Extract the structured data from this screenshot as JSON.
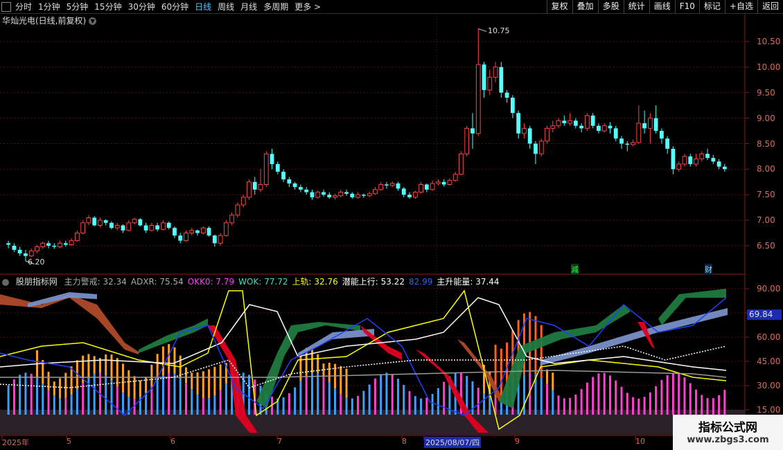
{
  "toolbar": {
    "periods": [
      "分时",
      "1分钟",
      "5分钟",
      "15分钟",
      "30分钟",
      "60分钟",
      "日线",
      "周线",
      "月线",
      "多周期",
      "更多 >"
    ],
    "active_period": "日线",
    "actions": [
      "复权",
      "叠加",
      "多股",
      "统计",
      "画线",
      "F10",
      "标记",
      "+自选",
      "返回"
    ]
  },
  "main_chart": {
    "title": "华灿光电(日线,前复权)",
    "price_axis": [
      "10.50",
      "10.00",
      "9.50",
      "9.00",
      "8.50",
      "8.00",
      "7.50",
      "7.00",
      "6.50"
    ],
    "high_label": "10.75",
    "low_label": "6.20",
    "marker_jian": "減",
    "marker_cai": "财"
  },
  "indicator": {
    "name": "股朋指标网",
    "fields": [
      {
        "label": "主力警戒: 32.34",
        "color": "#aaaaaa"
      },
      {
        "label": "ADXR: 75.54",
        "color": "#aaaaaa"
      },
      {
        "label": "OKK0: 7.79",
        "color": "#ff40ff"
      },
      {
        "label": "WOK: 77.72",
        "color": "#3fe0c0"
      },
      {
        "label": "上轨: 32.76",
        "color": "#ffff00"
      },
      {
        "label": "潜能上行: 53.22",
        "color": "#ffffff"
      },
      {
        "label": "82.99",
        "color": "#3060ff"
      },
      {
        "label": "主升能量: 37.44",
        "color": "#ffffff"
      }
    ],
    "axis": [
      "90.00",
      "75.00",
      "60.00",
      "45.00",
      "30.00",
      "15.00"
    ],
    "current_value": "69.84"
  },
  "date_axis": [
    "2025年",
    "5",
    "6",
    "7",
    "8",
    "2025/08/07/四",
    "9",
    "10"
  ],
  "watermark": {
    "line1": "指标公式网",
    "line2": "www.zbgs3.com"
  },
  "chart_data": {
    "type": "candlestick",
    "title": "华灿光电(日线,前复权)",
    "ylim": [
      6.0,
      11.0
    ],
    "high": 10.75,
    "low": 6.2,
    "candles": [
      [
        6.55,
        6.52,
        6.6,
        6.45
      ],
      [
        6.5,
        6.42,
        6.55,
        6.38
      ],
      [
        6.42,
        6.35,
        6.48,
        6.3
      ],
      [
        6.35,
        6.3,
        6.42,
        6.2
      ],
      [
        6.3,
        6.4,
        6.45,
        6.28
      ],
      [
        6.4,
        6.48,
        6.52,
        6.35
      ],
      [
        6.48,
        6.55,
        6.58,
        6.44
      ],
      [
        6.55,
        6.5,
        6.6,
        6.45
      ],
      [
        6.5,
        6.48,
        6.55,
        6.44
      ],
      [
        6.48,
        6.55,
        6.6,
        6.45
      ],
      [
        6.55,
        6.52,
        6.6,
        6.48
      ],
      [
        6.52,
        6.6,
        6.65,
        6.5
      ],
      [
        6.6,
        6.75,
        6.8,
        6.58
      ],
      [
        6.75,
        6.95,
        7.0,
        6.72
      ],
      [
        6.95,
        7.05,
        7.1,
        6.9
      ],
      [
        7.05,
        6.9,
        7.08,
        6.88
      ],
      [
        6.9,
        7.0,
        7.05,
        6.86
      ],
      [
        7.0,
        6.95,
        7.02,
        6.9
      ],
      [
        6.95,
        6.85,
        6.98,
        6.82
      ],
      [
        6.85,
        6.9,
        6.95,
        6.8
      ],
      [
        6.9,
        6.8,
        6.92,
        6.75
      ],
      [
        6.8,
        6.95,
        7.0,
        6.78
      ],
      [
        6.95,
        7.02,
        7.05,
        6.92
      ],
      [
        7.02,
        6.9,
        7.04,
        6.88
      ],
      [
        6.9,
        6.8,
        6.95,
        6.75
      ],
      [
        6.8,
        6.9,
        6.95,
        6.78
      ],
      [
        6.9,
        6.82,
        6.95,
        6.78
      ],
      [
        6.82,
        6.95,
        7.0,
        6.8
      ],
      [
        6.95,
        6.85,
        6.98,
        6.82
      ],
      [
        6.85,
        6.7,
        6.88,
        6.65
      ],
      [
        6.7,
        6.6,
        6.75,
        6.55
      ],
      [
        6.6,
        6.75,
        6.8,
        6.58
      ],
      [
        6.75,
        6.8,
        6.85,
        6.7
      ],
      [
        6.8,
        6.75,
        6.82,
        6.7
      ],
      [
        6.75,
        6.85,
        6.88,
        6.72
      ],
      [
        6.85,
        6.7,
        6.88,
        6.68
      ],
      [
        6.7,
        6.55,
        6.72,
        6.48
      ],
      [
        6.55,
        6.7,
        6.75,
        6.5
      ],
      [
        6.7,
        6.95,
        7.0,
        6.68
      ],
      [
        6.95,
        7.1,
        7.15,
        6.9
      ],
      [
        7.1,
        7.3,
        7.35,
        7.05
      ],
      [
        7.3,
        7.45,
        7.5,
        7.25
      ],
      [
        7.45,
        7.75,
        7.8,
        7.4
      ],
      [
        7.75,
        7.6,
        7.85,
        7.5
      ],
      [
        7.6,
        7.7,
        8.0,
        7.55
      ],
      [
        7.7,
        8.3,
        8.35,
        7.65
      ],
      [
        8.3,
        8.1,
        8.4,
        8.0
      ],
      [
        8.1,
        7.95,
        8.15,
        7.9
      ],
      [
        7.95,
        7.8,
        8.0,
        7.75
      ],
      [
        7.8,
        7.72,
        7.85,
        7.65
      ],
      [
        7.72,
        7.65,
        7.75,
        7.6
      ],
      [
        7.65,
        7.6,
        7.7,
        7.55
      ],
      [
        7.6,
        7.55,
        7.65,
        7.5
      ],
      [
        7.55,
        7.45,
        7.6,
        7.4
      ],
      [
        7.45,
        7.55,
        7.58,
        7.42
      ],
      [
        7.55,
        7.5,
        7.6,
        7.46
      ],
      [
        7.5,
        7.45,
        7.55,
        7.42
      ],
      [
        7.45,
        7.48,
        7.52,
        7.4
      ],
      [
        7.48,
        7.55,
        7.6,
        7.45
      ],
      [
        7.55,
        7.52,
        7.6,
        7.48
      ],
      [
        7.52,
        7.45,
        7.55,
        7.42
      ],
      [
        7.45,
        7.5,
        7.55,
        7.42
      ],
      [
        7.5,
        7.48,
        7.52,
        7.44
      ],
      [
        7.48,
        7.52,
        7.56,
        7.45
      ],
      [
        7.52,
        7.6,
        7.65,
        7.5
      ],
      [
        7.6,
        7.7,
        7.75,
        7.58
      ],
      [
        7.7,
        7.68,
        7.75,
        7.62
      ],
      [
        7.68,
        7.72,
        7.76,
        7.65
      ],
      [
        7.72,
        7.62,
        7.75,
        7.58
      ],
      [
        7.62,
        7.5,
        7.65,
        7.45
      ],
      [
        7.5,
        7.45,
        7.55,
        7.42
      ],
      [
        7.45,
        7.55,
        7.58,
        7.42
      ],
      [
        7.55,
        7.7,
        7.75,
        7.52
      ],
      [
        7.7,
        7.6,
        7.72,
        7.55
      ],
      [
        7.6,
        7.72,
        7.78,
        7.58
      ],
      [
        7.72,
        7.75,
        7.8,
        7.68
      ],
      [
        7.75,
        7.7,
        7.8,
        7.66
      ],
      [
        7.7,
        7.78,
        7.82,
        7.68
      ],
      [
        7.78,
        7.9,
        7.95,
        7.75
      ],
      [
        7.9,
        8.3,
        8.35,
        7.88
      ],
      [
        8.3,
        8.8,
        8.85,
        8.25
      ],
      [
        8.8,
        8.7,
        9.1,
        8.4
      ],
      [
        8.7,
        10.05,
        10.75,
        8.65
      ],
      [
        10.05,
        9.55,
        10.1,
        9.4
      ],
      [
        9.55,
        9.8,
        9.95,
        9.45
      ],
      [
        9.8,
        10.0,
        10.1,
        9.7
      ],
      [
        10.0,
        9.5,
        10.1,
        9.4
      ],
      [
        9.5,
        9.4,
        9.55,
        9.3
      ],
      [
        9.4,
        9.1,
        9.45,
        9.0
      ],
      [
        9.1,
        8.7,
        9.15,
        8.6
      ],
      [
        8.7,
        8.8,
        8.9,
        8.6
      ],
      [
        8.8,
        8.5,
        8.85,
        8.4
      ],
      [
        8.5,
        8.3,
        8.55,
        8.1
      ],
      [
        8.3,
        8.55,
        8.6,
        8.25
      ],
      [
        8.55,
        8.8,
        8.85,
        8.5
      ],
      [
        8.8,
        8.85,
        8.95,
        8.72
      ],
      [
        8.85,
        8.95,
        9.0,
        8.8
      ],
      [
        8.95,
        8.9,
        9.05,
        8.85
      ],
      [
        8.9,
        8.95,
        9.1,
        8.85
      ],
      [
        8.95,
        8.85,
        9.0,
        8.8
      ],
      [
        8.85,
        8.8,
        8.9,
        8.72
      ],
      [
        8.8,
        9.05,
        9.1,
        8.75
      ],
      [
        9.05,
        8.85,
        9.1,
        8.8
      ],
      [
        8.85,
        8.75,
        8.9,
        8.7
      ],
      [
        8.75,
        8.85,
        8.9,
        8.72
      ],
      [
        8.85,
        8.8,
        8.92,
        8.7
      ],
      [
        8.8,
        8.6,
        8.85,
        8.55
      ],
      [
        8.6,
        8.5,
        8.65,
        8.4
      ],
      [
        8.5,
        8.48,
        8.55,
        8.35
      ],
      [
        8.48,
        8.52,
        8.58,
        8.45
      ],
      [
        8.52,
        8.9,
        9.25,
        8.5
      ],
      [
        8.9,
        8.8,
        9.15,
        8.7
      ],
      [
        8.8,
        9.0,
        9.1,
        8.5
      ],
      [
        9.0,
        8.75,
        9.25,
        8.7
      ],
      [
        8.75,
        8.6,
        8.8,
        8.5
      ],
      [
        8.6,
        8.4,
        8.65,
        8.3
      ],
      [
        8.4,
        8.0,
        8.45,
        7.9
      ],
      [
        8.0,
        8.1,
        8.15,
        7.95
      ],
      [
        8.1,
        8.25,
        8.3,
        8.05
      ],
      [
        8.25,
        8.1,
        8.3,
        8.05
      ],
      [
        8.1,
        8.2,
        8.3,
        8.05
      ],
      [
        8.2,
        8.3,
        8.35,
        8.15
      ],
      [
        8.3,
        8.22,
        8.4,
        8.18
      ],
      [
        8.22,
        8.15,
        8.28,
        8.1
      ],
      [
        8.15,
        8.05,
        8.2,
        8.0
      ],
      [
        8.05,
        8.0,
        8.1,
        7.95
      ]
    ],
    "candle_fields": [
      "open",
      "close",
      "high",
      "low"
    ]
  }
}
